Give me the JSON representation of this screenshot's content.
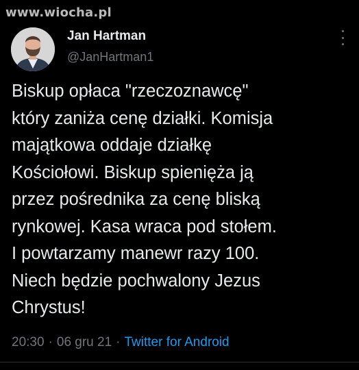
{
  "watermark": "www.wiocha.pl",
  "tweet": {
    "author": {
      "display_name": "Jan Hartman",
      "handle": "@JanHartman1"
    },
    "more_icon": "more-dots-icon",
    "lines": [
      "Biskup opłaca \"rzeczoznawcę\"",
      "który zaniża cenę działki. Komisja",
      "majątkowa oddaje działkę",
      "Kościołowi. Biskup spienięża ją",
      "przez pośrednika za cenę bliską",
      "rynkowej. Kasa wraca pod stołem.",
      "I powtarzamy manewr razy 100.",
      "Niech będzie pochwalony Jezus",
      "Chrystus!"
    ],
    "time": "20:30",
    "date": "06 gru 21",
    "separator": "·",
    "source": "Twitter for Android"
  },
  "colors": {
    "background": "#000000",
    "text": "#e7e9ea",
    "muted": "#71767b",
    "link": "#1d9bf0"
  }
}
